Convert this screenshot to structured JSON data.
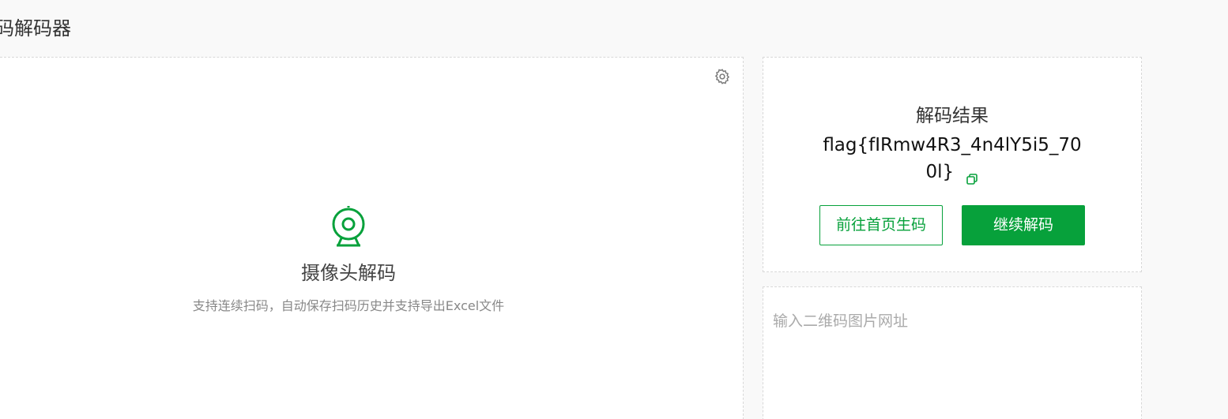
{
  "header": {
    "title": "码解码器"
  },
  "camera_panel": {
    "settings_icon": "gear-icon",
    "camera_icon": "webcam-icon",
    "title": "摄像头解码",
    "description": "支持连续扫码，自动保存扫码历史并支持导出Excel文件"
  },
  "result_panel": {
    "label": "解码结果",
    "value": "flag{fIRmw4R3_4n4lY5i5_700l}",
    "copy_icon": "copy-icon",
    "home_button": "前往首页生码",
    "continue_button": "继续解码"
  },
  "url_panel": {
    "placeholder": "输入二维码图片网址",
    "value": ""
  },
  "colors": {
    "accent": "#07a13b",
    "background": "#f9f9f9",
    "panel": "#ffffff",
    "border": "#d8d8d8"
  }
}
